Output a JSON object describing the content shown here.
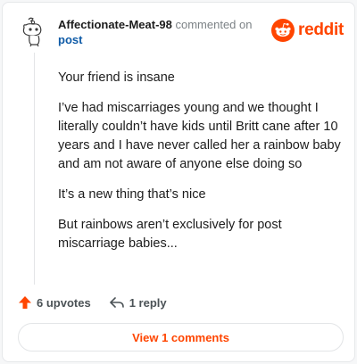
{
  "comment": {
    "username": "Affectionate-Meat-98",
    "commented_text": "commented on",
    "target_link": "post",
    "paragraphs": [
      "Your friend is insane",
      "I’ve had miscarriages young and we thought I literally couldn’t have kids until Britt cane after 10 years and I have never called her a rainbow baby and am not aware of anyone else doing so",
      "It’s a new thing that’s nice",
      "But rainbows aren’t exclusively for post miscarriage babies..."
    ]
  },
  "brand": {
    "wordmark": "reddit",
    "color": "#ff4500"
  },
  "actions": {
    "upvotes_label": "6 upvotes",
    "reply_label": "1 reply",
    "upvote_icon": "upvote-arrow-icon",
    "reply_icon": "reply-arrow-icon"
  },
  "footer": {
    "view_comments_label": "View 1 comments"
  }
}
